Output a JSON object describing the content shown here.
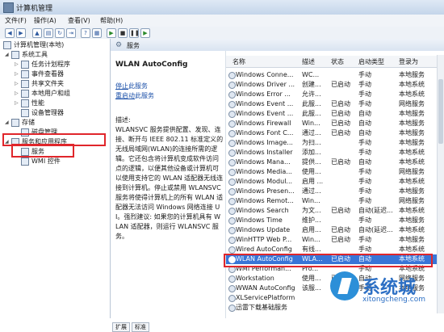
{
  "window": {
    "title": "计算机管理"
  },
  "menu": [
    "文件(F)",
    "操作(A)",
    "查看(V)",
    "帮助(H)"
  ],
  "tree": {
    "root": "计算机管理(本地)",
    "system_tools": "系统工具",
    "task_scheduler": "任务计划程序",
    "event_viewer": "事件查看器",
    "shared_folders": "共享文件夹",
    "local_users": "本地用户和组",
    "performance": "性能",
    "device_manager": "设备管理器",
    "storage": "存储",
    "disk_management": "磁盘管理",
    "services_apps": "服务和应用程序",
    "services": "服务",
    "wmi": "WMI 控件"
  },
  "header": {
    "label": "服务"
  },
  "detail": {
    "title": "WLAN AutoConfig",
    "stop_link": "停止",
    "stop_suffix": "此服务",
    "restart_link": "重启动",
    "restart_suffix": "此服务",
    "desc_heading": "描述:",
    "description": "WLANSVC 服务提供配置、发现、连接、断开与 IEEE 802.11 标准定义的无线局域网(WLAN)的连接所需的逻辑。它还包含将计算机变成软件访问点的逻辑，以便其他设备或计算机可以使用支持它的 WLAN 适配器无线连接到计算机。停止或禁用 WLANSVC 服务将使得计算机上的所有 WLAN 适配器无法访问 Windows 网络连接 UI。强烈建议: 如果您的计算机具有 WLAN 适配器，则运行 WLANSVC 服务。"
  },
  "tabs": [
    "扩展",
    "标准"
  ],
  "columns": [
    "名称",
    "描述",
    "状态",
    "启动类型",
    "登录为"
  ],
  "rows": [
    [
      "Windows Conne...",
      "WC...",
      "",
      "手动",
      "本地服务"
    ],
    [
      "Windows Driver ...",
      "创建...",
      "已启动",
      "手动",
      "本地系统"
    ],
    [
      "Windows Error ...",
      "允许...",
      "",
      "手动",
      "本地系统"
    ],
    [
      "Windows Event ...",
      "此服...",
      "已启动",
      "手动",
      "网络服务"
    ],
    [
      "Windows Event ...",
      "此服...",
      "已启动",
      "自动",
      "本地服务"
    ],
    [
      "Windows Firewall",
      "Win...",
      "已启动",
      "自动",
      "本地服务"
    ],
    [
      "Windows Font C...",
      "通过...",
      "已启动",
      "自动",
      "本地服务"
    ],
    [
      "Windows Image...",
      "为扫...",
      "",
      "手动",
      "本地服务"
    ],
    [
      "Windows Installer",
      "添加...",
      "",
      "手动",
      "本地系统"
    ],
    [
      "Windows Mana...",
      "提供...",
      "已启动",
      "自动",
      "本地系统"
    ],
    [
      "Windows Media...",
      "使用...",
      "",
      "手动",
      "网络服务"
    ],
    [
      "Windows Modul...",
      "启用 ...",
      "",
      "手动",
      "本地系统"
    ],
    [
      "Windows Presen...",
      "通过...",
      "",
      "手动",
      "本地服务"
    ],
    [
      "Windows Remot...",
      "Win...",
      "",
      "手动",
      "网络服务"
    ],
    [
      "Windows Search",
      "为文...",
      "已启动",
      "自动(延迟...",
      "本地系统"
    ],
    [
      "Windows Time",
      "维护...",
      "",
      "手动",
      "本地服务"
    ],
    [
      "Windows Update",
      "启用...",
      "已启动",
      "自动(延迟...",
      "本地系统"
    ],
    [
      "WinHTTP Web P...",
      "Win...",
      "已启动",
      "手动",
      "本地服务"
    ],
    [
      "Wired AutoConfig",
      "有线...",
      "",
      "手动",
      "本地系统"
    ],
    [
      "WLAN AutoConfig",
      "WLA...",
      "已启动",
      "自动",
      "本地系统"
    ],
    [
      "WMI Performan...",
      "Pro...",
      "",
      "手动",
      "本地系统"
    ],
    [
      "Workstation",
      "使用...",
      "已启动",
      "自动",
      "网络服务"
    ],
    [
      "WWAN AutoConfig",
      "该服...",
      "",
      "手动",
      "本地服务"
    ],
    [
      "XLServicePlatform",
      "",
      "",
      "",
      ""
    ],
    [
      "迅雷下载基础服务",
      "",
      "",
      "",
      ""
    ]
  ],
  "watermark": {
    "brand": "系统城",
    "url": "xitongcheng.com"
  }
}
